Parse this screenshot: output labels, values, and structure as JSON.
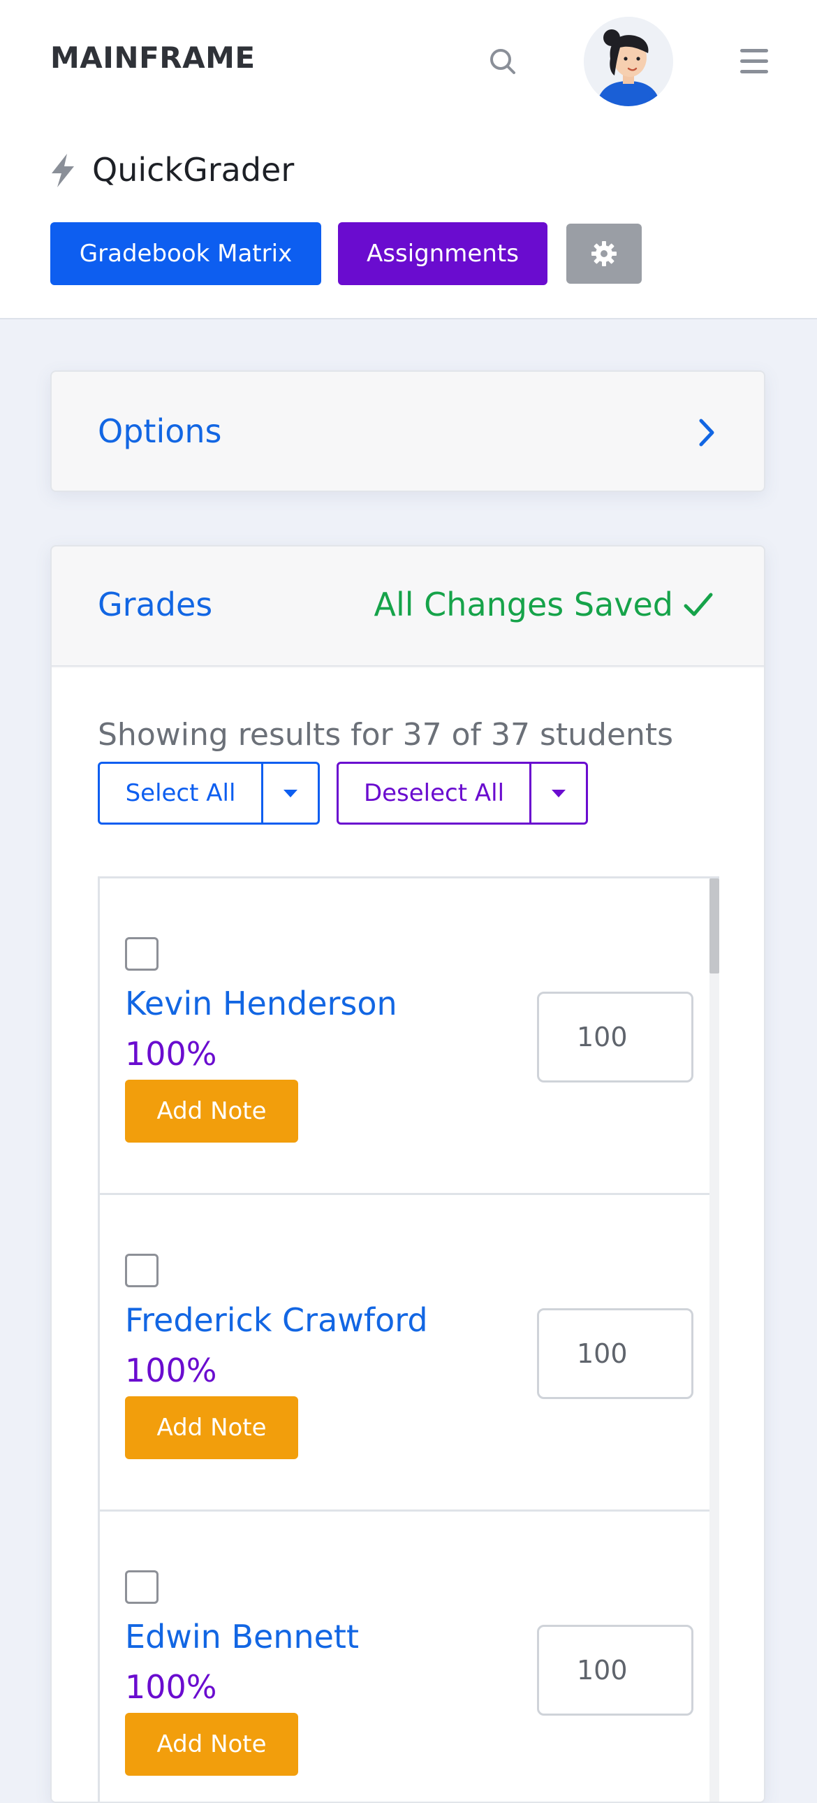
{
  "navbar": {
    "brand": "MAINFRAME",
    "search_icon": "search-icon",
    "avatar": "user-avatar",
    "menu_icon": "hamburger-menu-icon"
  },
  "header": {
    "icon": "lightning-bolt-icon",
    "title": "QuickGrader",
    "buttons": {
      "gradebook": "Gradebook Matrix",
      "assignments": "Assignments",
      "settings_icon": "gear-icon"
    }
  },
  "options": {
    "label": "Options",
    "chevron_icon": "chevron-right-icon"
  },
  "grades": {
    "label": "Grades",
    "status": "All Changes Saved",
    "status_icon": "check-icon",
    "showing": "Showing results for 37 of 37 students",
    "select_all": "Select All",
    "deselect_all": "Deselect All",
    "students": [
      {
        "name": "Kevin Henderson",
        "percent": "100%",
        "note_label": "Add Note",
        "score": "100"
      },
      {
        "name": "Frederick Crawford",
        "percent": "100%",
        "note_label": "Add Note",
        "score": "100"
      },
      {
        "name": "Edwin Bennett",
        "percent": "100%",
        "note_label": "Add Note",
        "score": "100"
      }
    ]
  },
  "colors": {
    "primary": "#0d5ef0",
    "purple": "#6a0ccf",
    "success": "#16a34a",
    "warning": "#f29e0c",
    "secondary": "#9a9ea5"
  }
}
